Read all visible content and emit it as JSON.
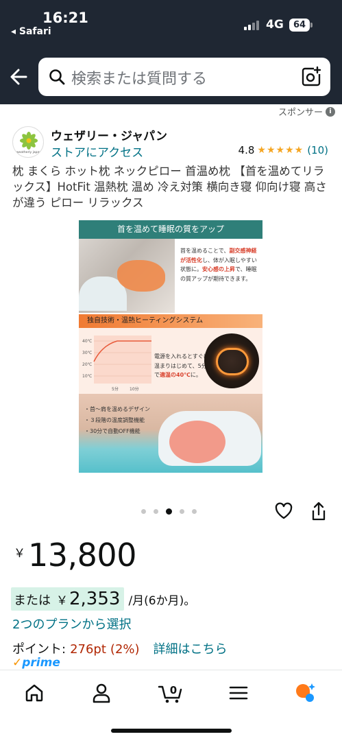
{
  "status": {
    "time": "16:21",
    "back_app": "◂ Safari",
    "network": "4G",
    "battery": "64"
  },
  "header": {
    "search_placeholder": "検索または質問する"
  },
  "sponsor": {
    "label": "スポンサー",
    "info": "i"
  },
  "brand": {
    "logo_text": "weatherly japan",
    "name": "ウェザリー・ジャパン",
    "store_link": "ストアにアクセス"
  },
  "rating": {
    "score": "4.8",
    "stars": 5,
    "count": "(10)"
  },
  "product": {
    "title": "枕 まくら ホット枕 ネックピロー 首温め枕 【首を温めてリラックス】HotFit 温熱枕 温め 冷え対策 横向き寝 仰向け寝 高さが違う ピロー リラックス"
  },
  "product_image": {
    "heading": "首を温めて睡眠の質をアップ",
    "text1_a": "首を温めることで、",
    "text1_red1": "副交感神経が活性化",
    "text1_b": "し、体が入眠しやすい状態に。",
    "text1_red2": "安心感の上昇",
    "text1_c": "で、睡眠の質アップが期待できます。",
    "section2": "独自技術・温熱ヒーティングシステム",
    "graph_y": [
      "40℃",
      "30℃",
      "20℃",
      "10℃"
    ],
    "graph_x": [
      "5分",
      "10分"
    ],
    "text2_a": "電源を入れるとすぐに温まりはじめて、5分で",
    "text2_red": "適温の40℃",
    "text2_b": "に。",
    "bullets": [
      "・首〜肩を温めるデザイン",
      "・３段階の温度調整機能",
      "・30分で自動OFF機能"
    ]
  },
  "carousel": {
    "count": 5,
    "active_index": 2
  },
  "price": {
    "currency": "￥",
    "amount": "13,800"
  },
  "installment": {
    "or_label": "または",
    "currency": "￥",
    "amount": "2,353",
    "period": "/月(6か月)。"
  },
  "plan_link": "2つのプランから選択",
  "points": {
    "label": "ポイント:",
    "value": "276pt",
    "percent": "(2%)",
    "detail_link": "詳細はこちら"
  },
  "prime": {
    "label": "prime"
  },
  "bottom_nav": {
    "cart_count": "0",
    "items": [
      "home-icon",
      "account-icon",
      "cart-icon",
      "menu-icon",
      "rufus-assistant-icon"
    ]
  },
  "colors": {
    "header_bg": "#1f2733",
    "link": "#007185",
    "price_red": "#b12704",
    "star": "#f5a623",
    "highlight": "#d7f2e7",
    "prime_blue": "#1a98ff"
  }
}
